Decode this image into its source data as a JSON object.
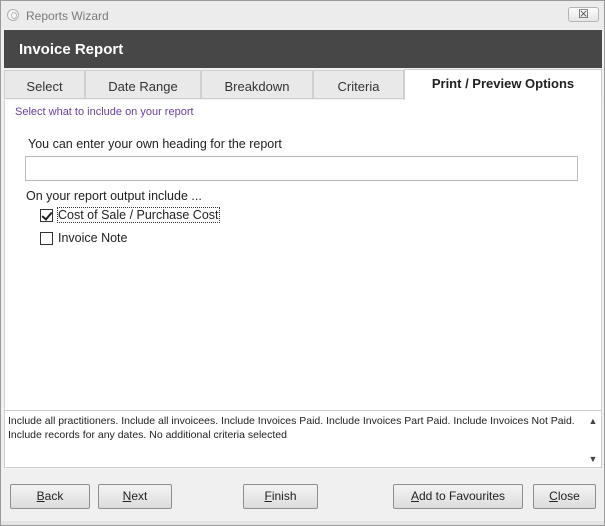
{
  "window": {
    "title": "Reports Wizard",
    "close_glyph": "☒"
  },
  "header": {
    "title": "Invoice Report"
  },
  "tabs": [
    {
      "label": "Select"
    },
    {
      "label": "Date Range"
    },
    {
      "label": "Breakdown"
    },
    {
      "label": "Criteria"
    },
    {
      "label": "Print / Preview Options",
      "active": true
    }
  ],
  "panel": {
    "hint": "Select what to include on your report",
    "heading_label": "You can enter your own heading for the report",
    "heading_value": "",
    "include_label": "On your report output include ...",
    "options": [
      {
        "label": "Cost of Sale / Purchase Cost",
        "checked": true
      },
      {
        "label": "Invoice Note",
        "checked": false
      }
    ]
  },
  "summary": {
    "text": "Include all practitioners. Include all invoicees. Include Invoices Paid. Include Invoices Part Paid. Include Invoices Not Paid. Include records for any dates. No additional criteria selected"
  },
  "buttons": {
    "back": {
      "first": "B",
      "rest": "ack"
    },
    "next": {
      "first": "N",
      "rest": "ext"
    },
    "finish": {
      "first": "F",
      "rest": "inish"
    },
    "favourites": {
      "first": "A",
      "rest": "dd to Favourites"
    },
    "close": {
      "first": "C",
      "rest": "lose"
    }
  },
  "colors": {
    "header_band": "#474747",
    "hint_text": "#6a3fa0"
  }
}
